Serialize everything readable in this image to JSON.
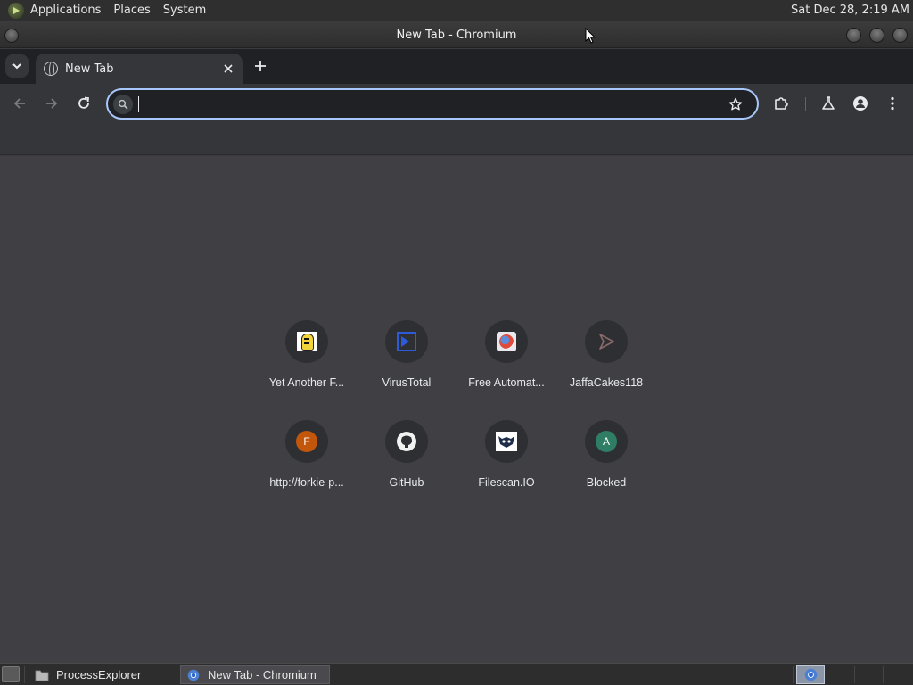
{
  "top_panel": {
    "menus": [
      "Applications",
      "Places",
      "System"
    ],
    "clock": "Sat Dec 28,  2:19 AM"
  },
  "window": {
    "title": "New Tab - Chromium"
  },
  "tabs": [
    {
      "title": "New Tab",
      "icon": "globe-icon"
    }
  ],
  "omnibox": {
    "value": "",
    "placeholder": ""
  },
  "shortcuts": [
    {
      "label": "Yet Another F...",
      "icon": "yaf-icon"
    },
    {
      "label": "VirusTotal",
      "icon": "virustotal-icon"
    },
    {
      "label": "Free Automat...",
      "icon": "free-automated-icon"
    },
    {
      "label": "JaffaCakes118",
      "icon": "jaffacakes-icon"
    },
    {
      "label": "http://forkie-p...",
      "icon": "letter-f-icon",
      "letter": "F"
    },
    {
      "label": "GitHub",
      "icon": "github-icon"
    },
    {
      "label": "Filescan.IO",
      "icon": "filescan-icon"
    },
    {
      "label": "Blocked",
      "icon": "letter-a-icon",
      "letter": "A"
    }
  ],
  "taskbar": {
    "items": [
      {
        "label": "ProcessExplorer",
        "icon": "folder-icon",
        "active": false
      },
      {
        "label": "New Tab - Chromium",
        "icon": "chromium-icon",
        "active": true
      }
    ]
  },
  "colors": {
    "accent": "#a8c7fa",
    "page_background": "#3f3f44",
    "toolbar": "#35363a",
    "tabstrip": "#202124",
    "letter_f": "#c2570c",
    "letter_a": "#2f7d64"
  }
}
